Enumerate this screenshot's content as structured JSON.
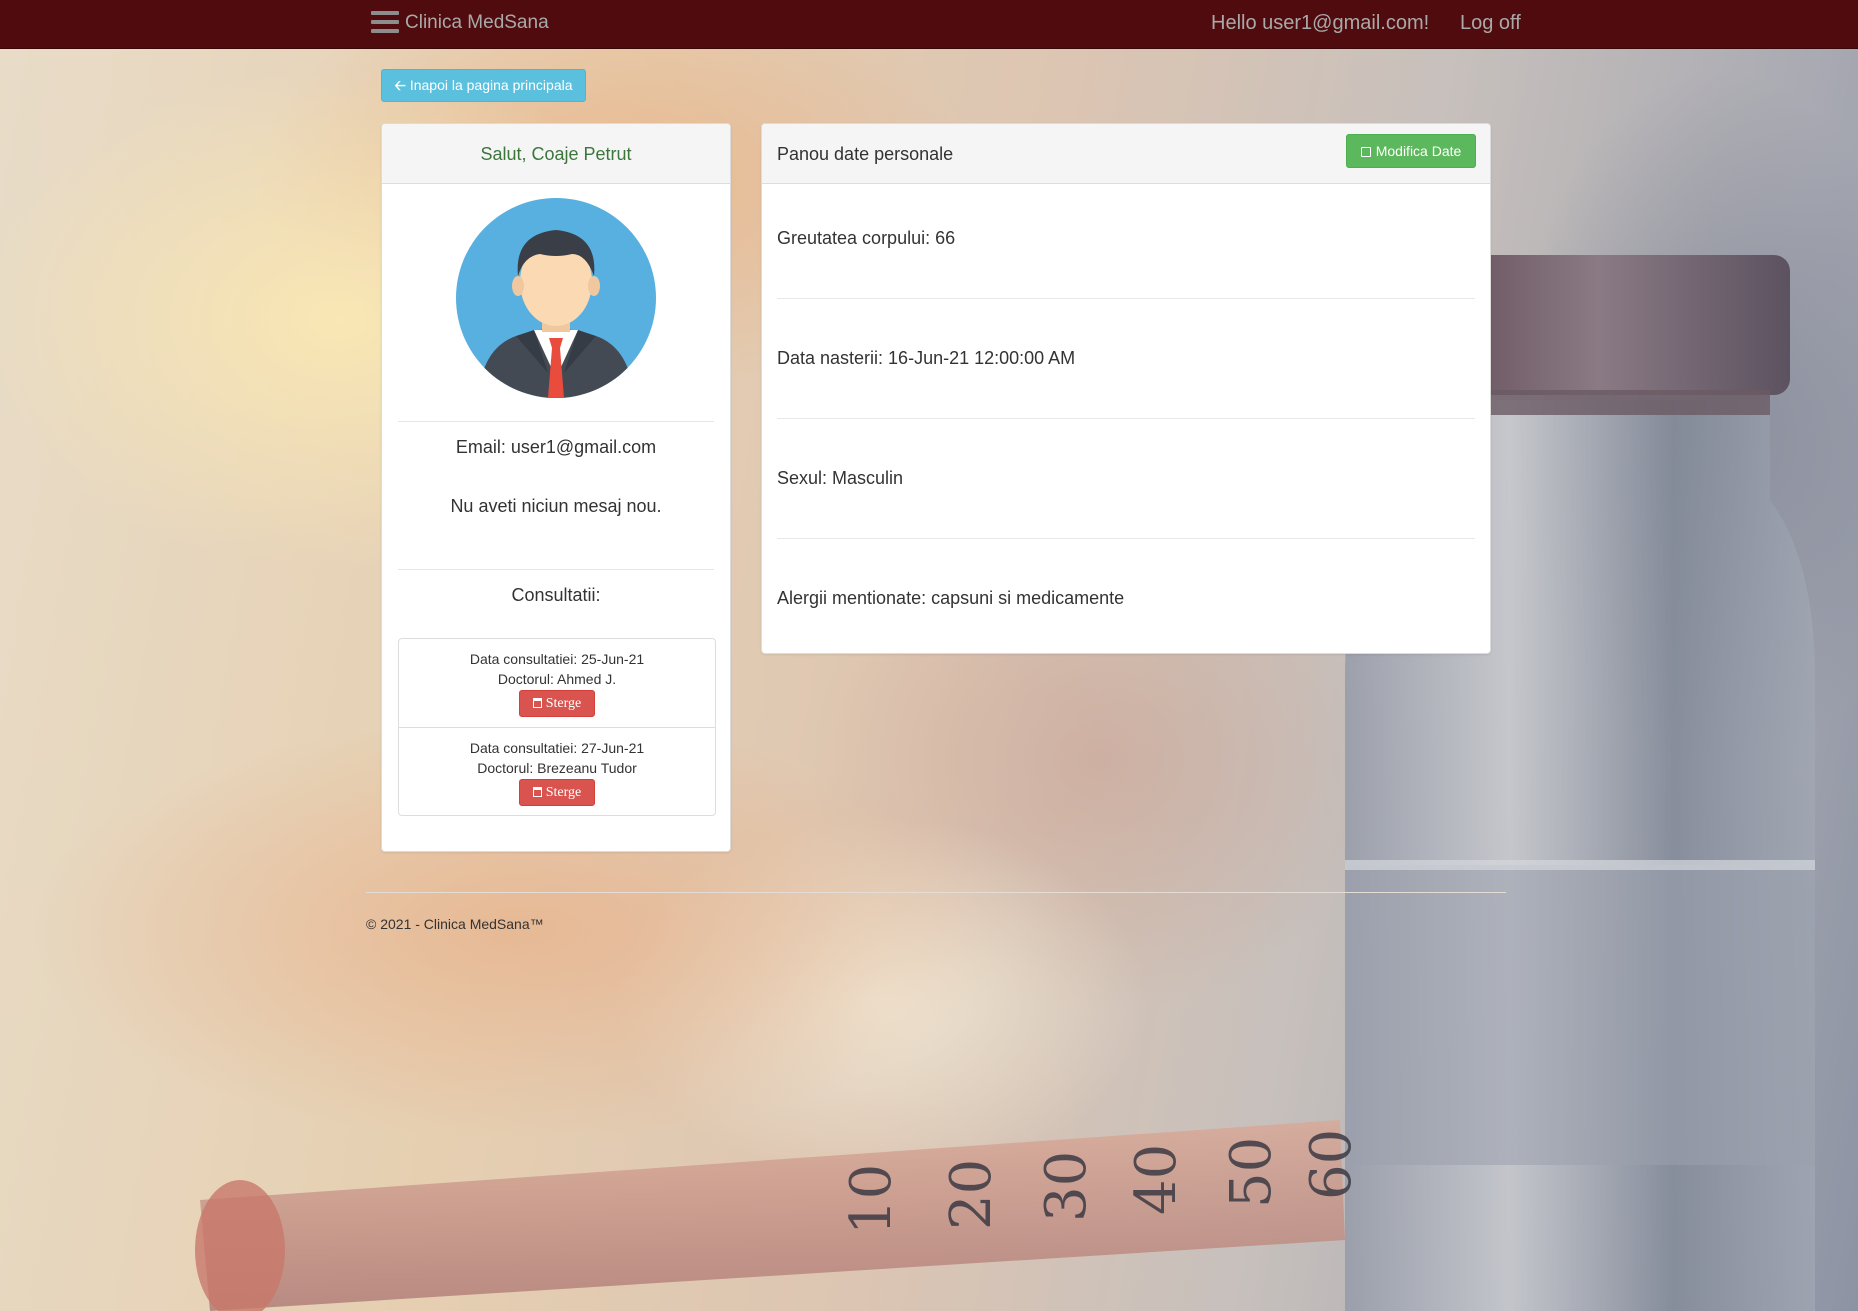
{
  "navbar": {
    "brand": "Clinica MedSana",
    "hello": "Hello user1@gmail.com!",
    "logoff": "Log off"
  },
  "back_button": "Inapoi la pagina principala",
  "profile": {
    "greeting": "Salut, Coaje Petrut",
    "email": "Email: user1@gmail.com",
    "messages": "Nu aveti niciun mesaj nou.",
    "consultations_title": "Consultatii:",
    "consultations": [
      {
        "date": "Data consultatiei: 25-Jun-21",
        "doctor": "Doctorul: Ahmed J.",
        "delete_label": "Sterge"
      },
      {
        "date": "Data consultatiei: 27-Jun-21",
        "doctor": "Doctorul: Brezeanu Tudor",
        "delete_label": "Sterge"
      }
    ]
  },
  "personal": {
    "title": "Panou date personale",
    "edit_button": "Modifica Date",
    "fields": [
      "Greutatea corpului: 66",
      "Data nasterii: 16-Jun-21 12:00:00 AM",
      "Sexul: Masculin",
      "Alergii mentionate: capsuni si medicamente"
    ]
  },
  "footer": "© 2021 - Clinica MedSana™",
  "colors": {
    "navbar": "#4f0b0e",
    "info_button": "#5bc0de",
    "success_button": "#5cb85c",
    "danger_button": "#d9534f",
    "greeting_text": "#3c763d"
  },
  "icons": {
    "menu": "hamburger-icon",
    "back": "arrow-left-icon",
    "edit": "edit-icon",
    "delete": "trash-icon",
    "avatar": "user-avatar"
  }
}
